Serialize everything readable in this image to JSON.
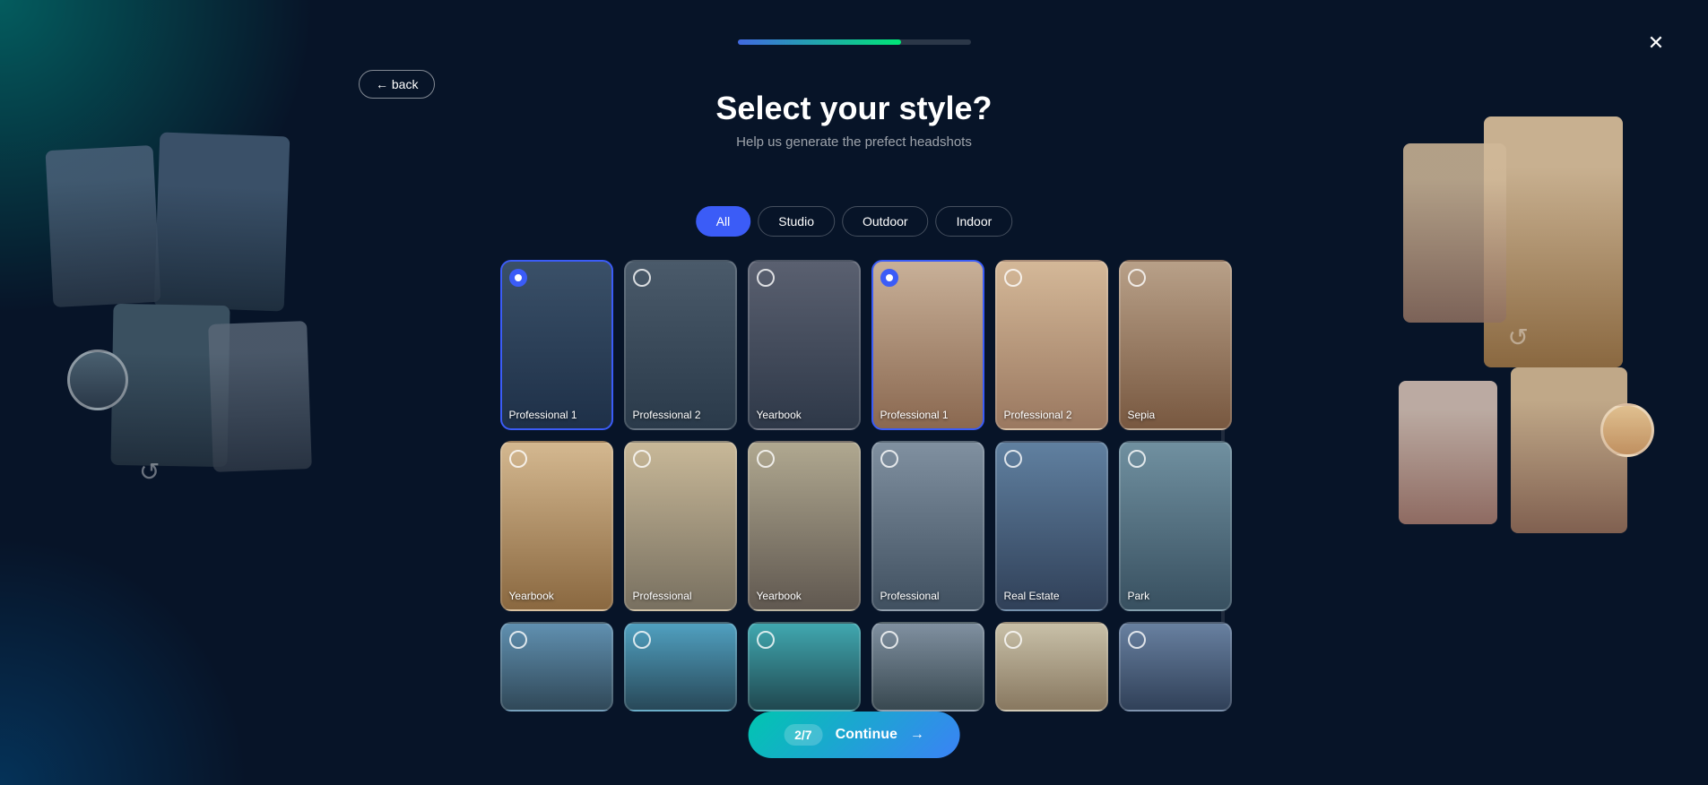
{
  "app": {
    "title": "Select your style?",
    "subtitle": "Help us generate the prefect headshots",
    "progress": 70,
    "step": "2/7"
  },
  "buttons": {
    "back": "← back",
    "close": "✕",
    "continue": "Continue",
    "continue_arrow": "→"
  },
  "filters": {
    "tabs": [
      "All",
      "Studio",
      "Outdoor",
      "Indoor"
    ],
    "active": "All"
  },
  "styles": {
    "row1": [
      {
        "label": "Professional 1",
        "selected": true
      },
      {
        "label": "Professional 2",
        "selected": false
      },
      {
        "label": "Yearbook",
        "selected": false
      },
      {
        "label": "Professional 1",
        "selected": true
      },
      {
        "label": "Professional 2",
        "selected": false
      },
      {
        "label": "Sepia",
        "selected": false
      }
    ],
    "row2": [
      {
        "label": "Yearbook",
        "selected": false
      },
      {
        "label": "Professional",
        "selected": false
      },
      {
        "label": "Yearbook",
        "selected": false
      },
      {
        "label": "Professional",
        "selected": false
      },
      {
        "label": "Real Estate",
        "selected": false
      },
      {
        "label": "Park",
        "selected": false
      }
    ],
    "row3": [
      {
        "label": "",
        "selected": false
      },
      {
        "label": "",
        "selected": false
      },
      {
        "label": "",
        "selected": false
      },
      {
        "label": "",
        "selected": false
      },
      {
        "label": "",
        "selected": false
      },
      {
        "label": "",
        "selected": false
      }
    ]
  },
  "card_colors": {
    "row1": [
      "#1e2d40",
      "#243040",
      "#2a3448",
      "#1e2d40",
      "#283548",
      "#2a2a30"
    ],
    "row2": [
      "#2a3848",
      "#283040",
      "#1e2a38",
      "#283848",
      "#1e3028",
      "#283038"
    ]
  }
}
